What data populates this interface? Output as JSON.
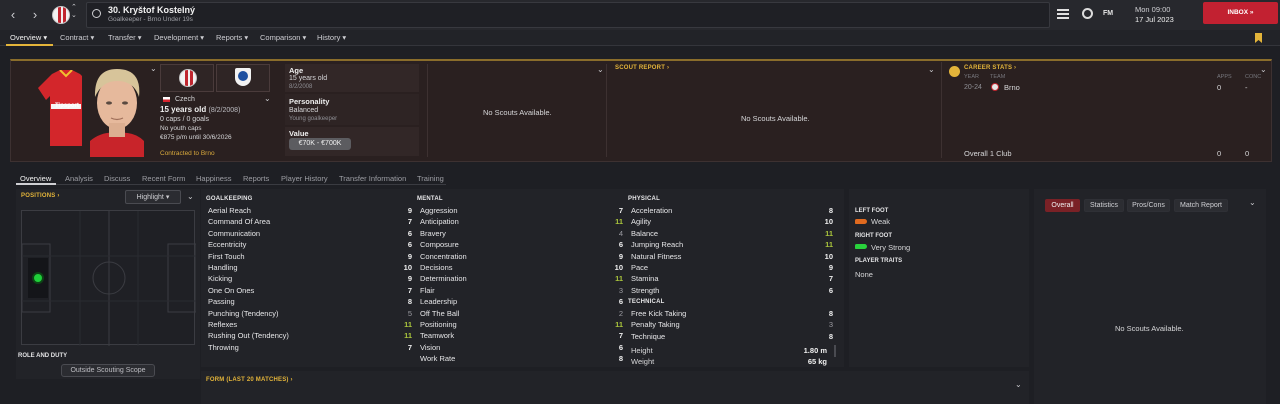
{
  "header": {
    "player_name": "30. Kryštof Kostelný",
    "player_subtitle": "Goalkeeper - Brno Under 19s",
    "date_day": "Mon 09:00",
    "date": "17 Jul 2023",
    "inbox_label": "INBOX",
    "fm_label": "FM"
  },
  "menu": [
    {
      "label": "Overview",
      "active": true
    },
    {
      "label": "Contract"
    },
    {
      "label": "Transfer"
    },
    {
      "label": "Development"
    },
    {
      "label": "Reports"
    },
    {
      "label": "Comparison"
    },
    {
      "label": "History"
    }
  ],
  "profile": {
    "nationality": "Czech",
    "age_line": "15 years old",
    "dob_paren": "(8/2/2008)",
    "caps": "0 caps / 0 goals",
    "youth_caps": "No youth caps",
    "wage": "€875 p/m until 30/6/2026",
    "contracted": "Contracted to Brno",
    "shirt_sponsor": "Tipsport"
  },
  "info": {
    "age_label": "Age",
    "age_value": "15 years old",
    "age_dob": "8/2/2008",
    "personality_label": "Personality",
    "personality_value": "Balanced",
    "personality_sub": "Young goalkeeper",
    "value_label": "Value",
    "value_value": "€70K - €700K"
  },
  "scouts": {
    "left_msg": "No Scouts Available.",
    "report_title": "SCOUT REPORT",
    "report_msg": "No Scouts Available."
  },
  "career": {
    "title": "CAREER STATS",
    "col_year": "YEAR",
    "col_team": "TEAM",
    "col_apps": "APPS",
    "col_conc": "CONC",
    "row_year": "20-24",
    "row_team": "Brno",
    "row_apps": "0",
    "row_conc": "-",
    "total_label": "Overall 1 Club",
    "total_apps": "0",
    "total_conc": "0"
  },
  "subtabs": [
    "Overview",
    "Analysis",
    "Discuss",
    "Recent Form",
    "Happiness",
    "Reports",
    "Player History",
    "Transfer Information",
    "Training"
  ],
  "positions": {
    "title": "POSITIONS",
    "highlight": "Highlight",
    "role_title": "ROLE AND DUTY",
    "role_value": "Outside Scouting Scope"
  },
  "goalkeeping": {
    "title": "GOALKEEPING",
    "rows": [
      {
        "name": "Aerial Reach",
        "value": "9",
        "tone": "w"
      },
      {
        "name": "Command Of Area",
        "value": "7",
        "tone": "w"
      },
      {
        "name": "Communication",
        "value": "6",
        "tone": "w"
      },
      {
        "name": "Eccentricity",
        "value": "6",
        "tone": "w"
      },
      {
        "name": "First Touch",
        "value": "9",
        "tone": "w"
      },
      {
        "name": "Handling",
        "value": "10",
        "tone": "w"
      },
      {
        "name": "Kicking",
        "value": "9",
        "tone": "w"
      },
      {
        "name": "One On Ones",
        "value": "7",
        "tone": "w"
      },
      {
        "name": "Passing",
        "value": "8",
        "tone": "w"
      },
      {
        "name": "Punching (Tendency)",
        "value": "5",
        "tone": "l"
      },
      {
        "name": "Reflexes",
        "value": "11",
        "tone": "g"
      },
      {
        "name": "Rushing Out (Tendency)",
        "value": "11",
        "tone": "g"
      },
      {
        "name": "Throwing",
        "value": "7",
        "tone": "w"
      }
    ]
  },
  "mental": {
    "title": "MENTAL",
    "rows": [
      {
        "name": "Aggression",
        "value": "7",
        "tone": "w"
      },
      {
        "name": "Anticipation",
        "value": "11",
        "tone": "g"
      },
      {
        "name": "Bravery",
        "value": "4",
        "tone": "l"
      },
      {
        "name": "Composure",
        "value": "6",
        "tone": "w"
      },
      {
        "name": "Concentration",
        "value": "9",
        "tone": "w"
      },
      {
        "name": "Decisions",
        "value": "10",
        "tone": "w"
      },
      {
        "name": "Determination",
        "value": "11",
        "tone": "g"
      },
      {
        "name": "Flair",
        "value": "3",
        "tone": "l"
      },
      {
        "name": "Leadership",
        "value": "6",
        "tone": "w"
      },
      {
        "name": "Off The Ball",
        "value": "2",
        "tone": "l"
      },
      {
        "name": "Positioning",
        "value": "11",
        "tone": "g"
      },
      {
        "name": "Teamwork",
        "value": "7",
        "tone": "w"
      },
      {
        "name": "Vision",
        "value": "6",
        "tone": "w"
      },
      {
        "name": "Work Rate",
        "value": "8",
        "tone": "w"
      }
    ]
  },
  "physical": {
    "title": "PHYSICAL",
    "rows": [
      {
        "name": "Acceleration",
        "value": "8",
        "tone": "w"
      },
      {
        "name": "Agility",
        "value": "10",
        "tone": "w"
      },
      {
        "name": "Balance",
        "value": "11",
        "tone": "g"
      },
      {
        "name": "Jumping Reach",
        "value": "11",
        "tone": "g"
      },
      {
        "name": "Natural Fitness",
        "value": "10",
        "tone": "w"
      },
      {
        "name": "Pace",
        "value": "9",
        "tone": "w"
      },
      {
        "name": "Stamina",
        "value": "7",
        "tone": "w"
      },
      {
        "name": "Strength",
        "value": "6",
        "tone": "w"
      }
    ]
  },
  "technical": {
    "title": "TECHNICAL",
    "rows": [
      {
        "name": "Free Kick Taking",
        "value": "8",
        "tone": "w"
      },
      {
        "name": "Penalty Taking",
        "value": "3",
        "tone": "l"
      },
      {
        "name": "Technique",
        "value": "8",
        "tone": "w"
      }
    ]
  },
  "body": {
    "height_label": "Height",
    "height_value": "1.80 m",
    "weight_label": "Weight",
    "weight_value": "65 kg"
  },
  "feet": {
    "left_title": "LEFT FOOT",
    "left_value": "Weak",
    "right_title": "RIGHT FOOT",
    "right_value": "Very Strong",
    "traits_title": "PLAYER TRAITS",
    "traits_value": "None"
  },
  "right_panel": {
    "tabs": [
      "Overall",
      "Statistics",
      "Pros/Cons",
      "Match Report"
    ],
    "msg": "No Scouts Available."
  },
  "form": {
    "title": "FORM (LAST 20 MATCHES)"
  },
  "colors": {
    "accent": "#e3b43a",
    "brand": "#c22131",
    "good": "#a9c43c"
  }
}
